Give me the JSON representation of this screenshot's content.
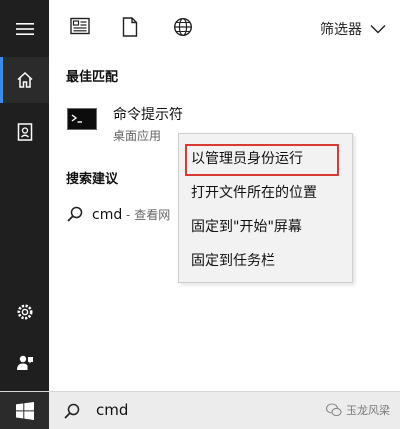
{
  "toolbar": {
    "icons": [
      "document-grid-icon",
      "file-icon",
      "globe-icon"
    ],
    "filter_label": "筛选器",
    "filter_icon": "chevron-down-icon"
  },
  "rail": {
    "items": [
      "hamburger-menu-icon",
      "home-icon",
      "notebook-icon",
      "settings-icon",
      "feedback-icon"
    ],
    "active": "home-icon",
    "accent": "#3a8ee6"
  },
  "best_match": {
    "section_title": "最佳匹配",
    "app_name": "命令提示符",
    "app_type": "桌面应用",
    "app_icon": "command-prompt-icon"
  },
  "search_suggestions": {
    "section_title": "搜索建议",
    "items": [
      {
        "query": "cmd",
        "hint": " - 查看网"
      }
    ]
  },
  "context_menu": {
    "items": [
      {
        "label": "以管理员身份运行",
        "highlighted": true
      },
      {
        "label": "打开文件所在的位置",
        "highlighted": false
      },
      {
        "label": "固定到\"开始\"屏幕",
        "highlighted": false
      },
      {
        "label": "固定到任务栏",
        "highlighted": false
      }
    ],
    "highlight_color": "#d93a33"
  },
  "taskbar": {
    "search_query": "cmd",
    "start_icon": "windows-logo-icon"
  },
  "watermark": {
    "text": "玉龙风梁"
  }
}
